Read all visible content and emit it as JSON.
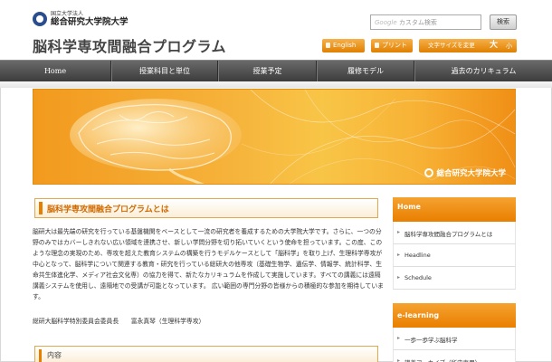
{
  "header": {
    "logo_small": "国立大学法人",
    "logo_large": "総合研究大学院大学",
    "site_title": "脳科学専攻間融合プログラム",
    "search_placeholder": "カスタム検索",
    "search_button": "検索",
    "english_button": "English",
    "print_button": "プリント",
    "fontsize_label": "文字サイズを変更",
    "fontsize_large": "大",
    "fontsize_small": "小"
  },
  "nav": {
    "items": [
      "Home",
      "授業科目と単位",
      "授業予定",
      "履修モデル",
      "過去のカリキュラム"
    ]
  },
  "banner": {
    "caption": "総合研究大学院大学"
  },
  "main": {
    "section_title": "脳科学専攻間融合プログラムとは",
    "body": "脳研大は最先端の研究を行っている基盤機関をベースとして一流の研究者を養成するための大学院大学です。さらに、一つの分野のみではカバーしきれない広い領域を連携させ、新しい学問分野を切り拓いていくという使命を担っています。この度、このような理念の実現のため、専攻を超えた教育システムの構築を行うモデルケースとして「脳科学」を取り上げ、生理科学専攻が中心となって、脳科学について関連する教育・研究を行っている総研大の他専攻（基礎生物学、遺伝学、情報学、統計科学、生命共生体進化学、メディア社会文化専）の協力を得て、新たなカリキュラムを作成して実施しています。すべての講義には遠隔講義システムを使用し、遠隔地での受講が可能となっています。 広い範囲の専門分野の皆様からの積極的な参加を期待しています。",
    "signature": "総研大脳科学特別委員会委員長　　富永真琴（生理科学専攻）",
    "section2_title": "内容"
  },
  "sidebar": {
    "home_title": "Home",
    "home_items": [
      "脳科学専攻間融合プログラムとは",
      "Headline",
      "Schedule"
    ],
    "elearning_title": "e-learning",
    "elearning_items": [
      "一歩一歩学ぶ脳科学",
      "講義アーカイブ（所内専用）"
    ]
  },
  "colors": {
    "accent_orange": "#e97f00",
    "nav_dark": "#3c3c3c"
  }
}
